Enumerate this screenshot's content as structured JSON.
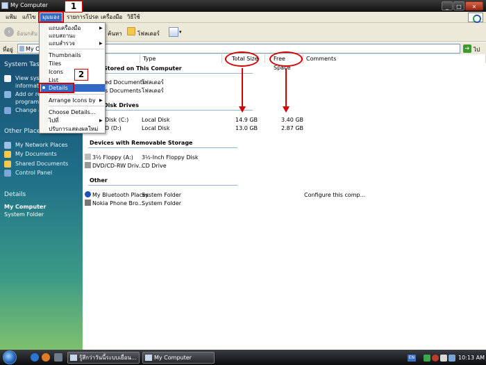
{
  "window": {
    "title": "My Computer"
  },
  "menubar": {
    "items": [
      "แฟ้ม",
      "แก้ไข",
      "มุมมอง",
      "รายการโปรด",
      "เครื่องมือ",
      "วิธีใช้"
    ]
  },
  "toolbar": {
    "back_label": "ย้อนกลับ",
    "search_label": "ค้นหา",
    "folders_label": "โฟลเดอร์"
  },
  "address": {
    "label": "ที่อยู่",
    "value": "My C",
    "go_label": "ไป"
  },
  "left_pane": {
    "system_tasks_title": "System Tasks",
    "system_tasks": [
      "View syst",
      "informatio",
      "Add or re",
      "programs",
      "Change a"
    ],
    "other_places_title": "Other Places",
    "other_places": [
      "My Network Places",
      "My Documents",
      "Shared Documents",
      "Control Panel"
    ],
    "details_title": "Details",
    "details_name": "My Computer",
    "details_type": "System Folder"
  },
  "columns": {
    "type": "Type",
    "total_size": "Total Size",
    "free_space": "Free Space",
    "comments": "Comments"
  },
  "groups": {
    "stored": "Stored on This Computer",
    "hdd": "Disk Drives",
    "removable": "Devices with Removable Storage",
    "other": "Other"
  },
  "stored_items": [
    {
      "name": "ed Documents",
      "type": "โฟลเดอร์"
    },
    {
      "name": "s Documents",
      "type": "โฟลเดอร์"
    }
  ],
  "disk_items": [
    {
      "name": "Disk (C:)",
      "type": "Local Disk",
      "total": "14.9 GB",
      "free": "3.40 GB"
    },
    {
      "name": "D (D:)",
      "type": "Local Disk",
      "total": "13.0 GB",
      "free": "2.87 GB"
    }
  ],
  "removable_items": [
    {
      "name": "3½ Floppy (A:)",
      "type": "3½-Inch Floppy Disk"
    },
    {
      "name": "DVD/CD-RW Driv...",
      "type": "CD Drive"
    }
  ],
  "other_items": [
    {
      "name": "My Bluetooth Places",
      "type": "System Folder",
      "comment": "Configure this comp..."
    },
    {
      "name": "Nokia Phone Bro...",
      "type": "System Folder",
      "comment": ""
    }
  ],
  "view_menu": {
    "items": [
      "แถบเครื่องมือ",
      "แถบสถานะ",
      "แถบสำรวจ",
      "Thumbnails",
      "Tiles",
      "Icons",
      "List",
      "Details",
      "Arrange Icons by",
      "Choose Details...",
      "ไปที่",
      "ปรับการแสดงผลใหม่"
    ]
  },
  "annotations": {
    "step1": "1",
    "step2": "2"
  },
  "taskbar": {
    "buttons": [
      "รู้สึกว่าวันนี้ระบบเยื่อน...",
      "My Computer"
    ],
    "lang": "EN",
    "clock": "10:13 AM"
  },
  "colors": {
    "annotation_red": "#d40000",
    "menu_highlight": "#3169c6"
  }
}
